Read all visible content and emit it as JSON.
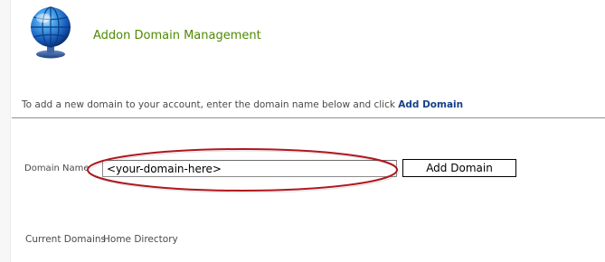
{
  "header": {
    "title": "Addon Domain Management",
    "icon": "globe-icon"
  },
  "instructions": {
    "text": "To add a new domain to your account, enter the domain name below and click ",
    "emphasis": "Add Domain"
  },
  "form": {
    "domain_label": "Domain Name",
    "domain_value": "<your-domain-here>",
    "submit_label": "Add Domain",
    "highlight_color": "#b0171f"
  },
  "table": {
    "columns": [
      "Current Domains",
      "Home Directory"
    ]
  },
  "colors": {
    "title": "#4e8a00",
    "link": "#173f86",
    "text": "#4a4a4a"
  }
}
